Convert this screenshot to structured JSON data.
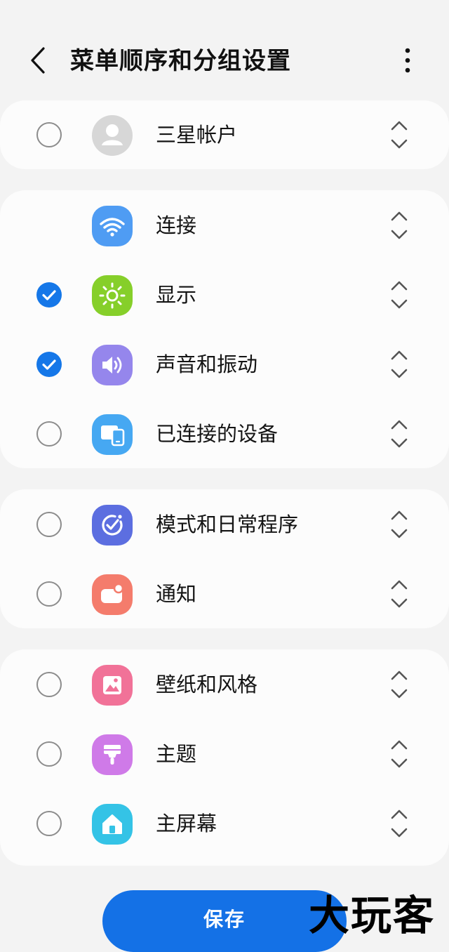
{
  "header": {
    "title": "菜单顺序和分组设置",
    "back_icon": "chevron-left-icon",
    "more_icon": "more-vertical-icon"
  },
  "colors": {
    "accent": "#1577e8",
    "save_button": "#1471e6",
    "background": "#f3f3f3",
    "card": "#fcfcfc"
  },
  "groups": [
    {
      "items": [
        {
          "label": "三星帐户",
          "icon": "account-icon",
          "icon_color": "#d7d7d7",
          "checkbox": "unchecked"
        }
      ]
    },
    {
      "items": [
        {
          "label": "连接",
          "icon": "wifi-icon",
          "icon_color": "#4f9cf3",
          "checkbox": "none"
        },
        {
          "label": "显示",
          "icon": "sun-icon",
          "icon_color": "#86cf2a",
          "checkbox": "checked"
        },
        {
          "label": "声音和振动",
          "icon": "speaker-icon",
          "icon_color": "#9586ec",
          "checkbox": "checked"
        },
        {
          "label": "已连接的设备",
          "icon": "devices-icon",
          "icon_color": "#46a8f2",
          "checkbox": "unchecked"
        }
      ]
    },
    {
      "items": [
        {
          "label": "模式和日常程序",
          "icon": "modes-icon",
          "icon_color": "#5c6ee0",
          "checkbox": "unchecked"
        },
        {
          "label": "通知",
          "icon": "notification-icon",
          "icon_color": "#f47c6c",
          "checkbox": "unchecked"
        }
      ]
    },
    {
      "items": [
        {
          "label": "壁纸和风格",
          "icon": "wallpaper-icon",
          "icon_color": "#f17298",
          "checkbox": "unchecked"
        },
        {
          "label": "主题",
          "icon": "theme-brush-icon",
          "icon_color": "#cf7ae8",
          "checkbox": "unchecked"
        },
        {
          "label": "主屏幕",
          "icon": "home-icon",
          "icon_color": "#34c3e6",
          "checkbox": "unchecked"
        }
      ]
    }
  ],
  "footer": {
    "save_label": "保存"
  },
  "watermark": "大玩客"
}
